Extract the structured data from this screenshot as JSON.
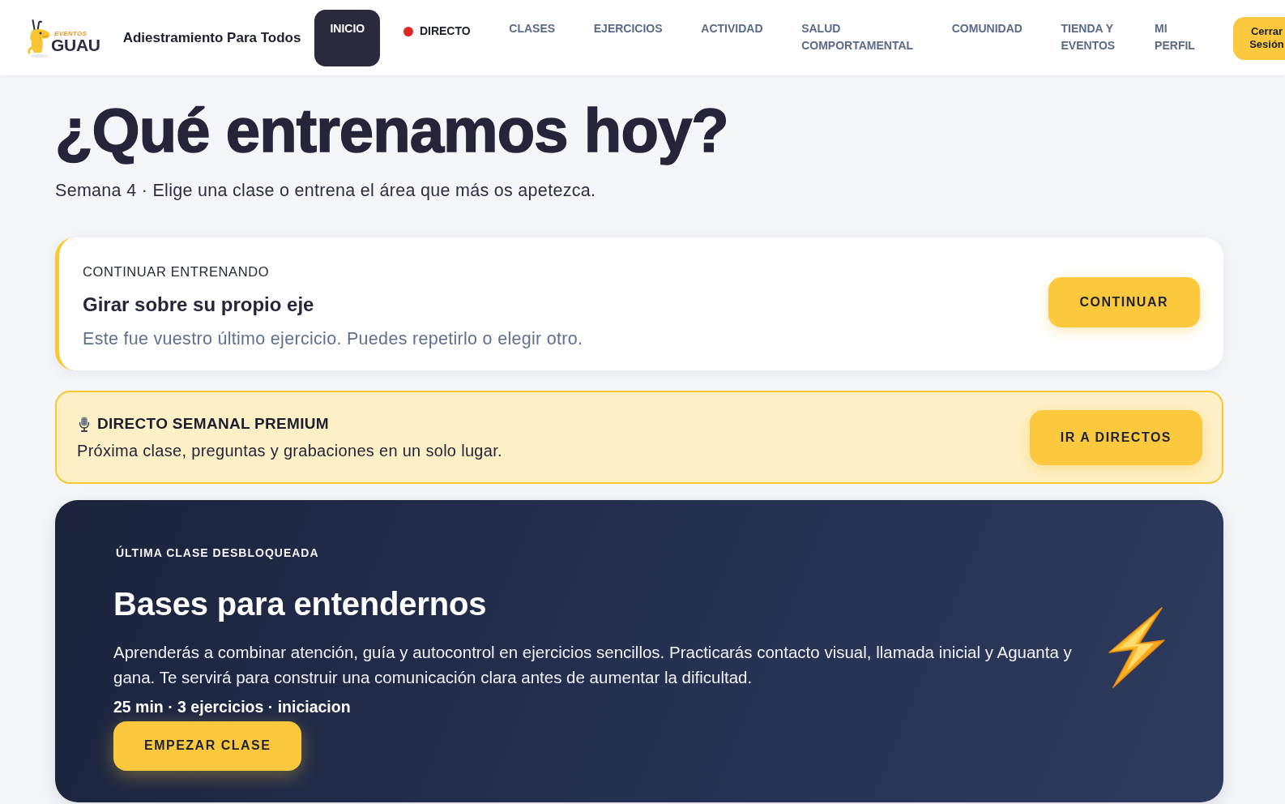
{
  "header": {
    "logo": {
      "small_text": "EVENTOS",
      "text": "GUAU"
    },
    "brand": "Adiestramiento Para Todos",
    "nav": [
      {
        "label": "INICIO",
        "selected": true,
        "live": false
      },
      {
        "label": "DIRECTO",
        "selected": false,
        "live": true
      },
      {
        "label": "CLASES",
        "selected": false,
        "live": false
      },
      {
        "label": "EJERCICIOS",
        "selected": false,
        "live": false
      },
      {
        "label": "ACTIVIDAD",
        "selected": false,
        "live": false
      },
      {
        "label": "SALUD COMPORTAMENTAL",
        "selected": false,
        "live": false
      },
      {
        "label": "COMUNIDAD",
        "selected": false,
        "live": false
      },
      {
        "label": "TIENDA Y EVENTOS",
        "selected": false,
        "live": false
      },
      {
        "label": "MI PERFIL",
        "selected": false,
        "live": false
      }
    ],
    "logout_button": "Cerrar Sesión"
  },
  "intro": {
    "title": "¿Qué entrenamos hoy?",
    "subtitle": "Semana 4 · Elige una clase o entrena el área que más os apetezca."
  },
  "continue_card": {
    "label": "CONTINUAR ENTRENANDO",
    "title": "Girar sobre su propio eje",
    "description": "Este fue vuestro último ejercicio. Puedes repetirlo o elegir otro.",
    "button": "CONTINUAR"
  },
  "live_banner": {
    "title": "DIRECTO SEMANAL PREMIUM",
    "description": "Próxima clase, preguntas y grabaciones en un solo lugar.",
    "button": "IR A DIRECTOS"
  },
  "latest_class": {
    "label": "ÚLTIMA CLASE DESBLOQUEADA",
    "title": "Bases para entendernos",
    "description": "Aprenderás a combinar atención, guía y autocontrol en ejercicios sencillos. Practicarás contacto visual, llamada inicial y Aguanta y gana. Te servirá para construir una comunicación clara antes de aumentar la dificultad.",
    "meta": "25 min · 3 ejercicios · iniciacion",
    "button": "EMPEZAR CLASE"
  }
}
